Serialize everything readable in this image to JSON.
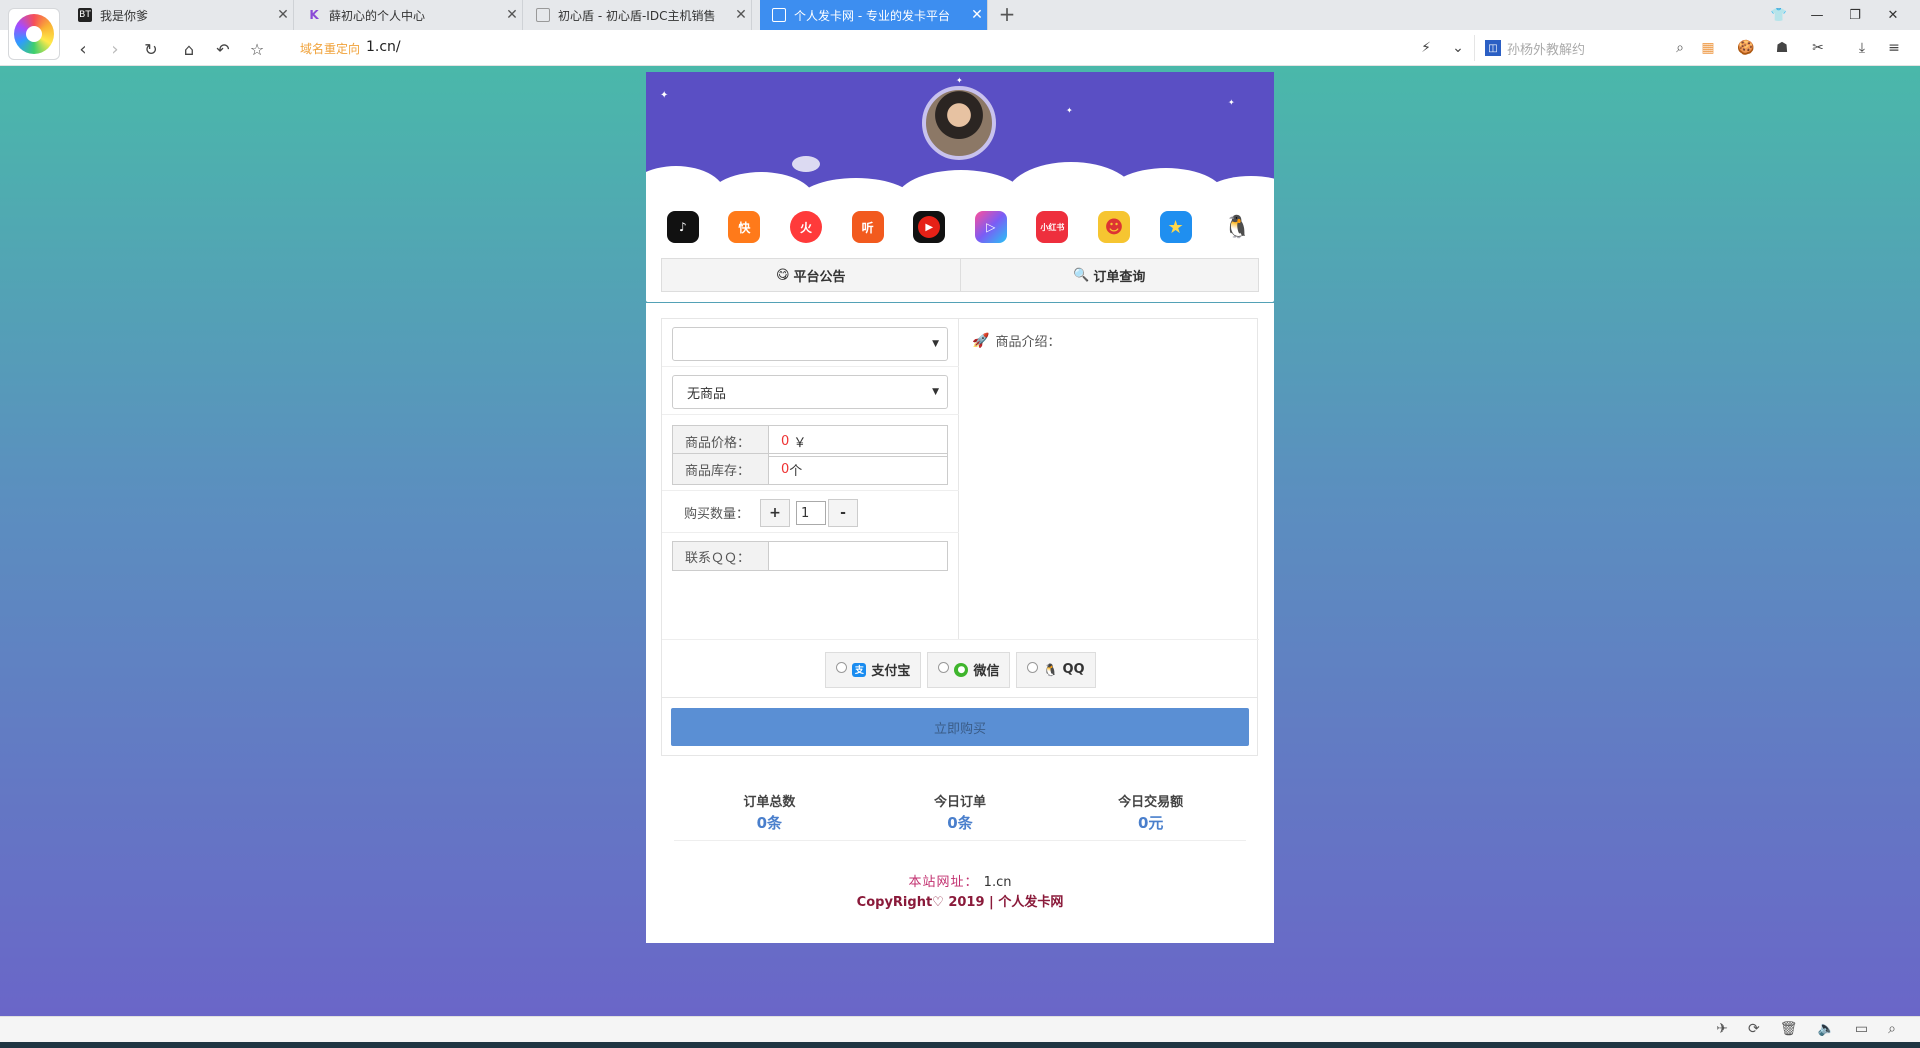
{
  "browser": {
    "tabs": [
      {
        "favicon": "BT",
        "title": "我是你爹"
      },
      {
        "favicon": "K",
        "title": "薛初心的个人中心"
      },
      {
        "favicon": "doc-icon",
        "title": "初心盾 - 初心盾-IDC主机销售"
      },
      {
        "favicon": "doc-icon",
        "title": "个人发卡网 - 专业的发卡平台"
      }
    ],
    "address": {
      "redirect_label": "域名重定向",
      "url": "1.cn/"
    },
    "search_placeholder": "孙杨外教解约"
  },
  "hero": {
    "apps": [
      {
        "name": "douyin",
        "label": "♪",
        "color": "#111111"
      },
      {
        "name": "kuaishou",
        "label": "快",
        "color": "#ff7a1a"
      },
      {
        "name": "huoshan",
        "label": "火",
        "color": "#ff3a3a"
      },
      {
        "name": "huoshan-listen",
        "label": "听",
        "color": "#f25a1e"
      },
      {
        "name": "youtube",
        "label": "▶",
        "color": "#e62117"
      },
      {
        "name": "weishi",
        "label": "▷",
        "color": "#7b5cf5"
      },
      {
        "name": "xiaohongshu",
        "label": "小红书",
        "color": "#ee2f3d"
      },
      {
        "name": "face-app",
        "label": "☻",
        "color": "#f6c531"
      },
      {
        "name": "star-app",
        "label": "★",
        "color": "#1f8ff0"
      },
      {
        "name": "qq",
        "label": "🐧",
        "color": "#ffffff"
      }
    ],
    "notice_label": "平台公告",
    "query_label": "订单查询"
  },
  "form": {
    "category_value": "",
    "product_value": "无商品",
    "price_label": "商品价格：",
    "price_value": "0",
    "price_unit": "￥",
    "stock_label": "商品库存：",
    "stock_value": "0",
    "stock_unit": "个",
    "qty_label": "购买数量：",
    "qty_plus": "+",
    "qty_value": "1",
    "qty_minus": "-",
    "qq_label": "联系ＱＱ：",
    "qq_value": "",
    "intro_label": "商品介绍："
  },
  "payment": [
    {
      "label": "支付宝",
      "icon": "alipay-icon",
      "color": "#1a8cf0",
      "glyph": "支"
    },
    {
      "label": "微信",
      "icon": "wechat-icon",
      "color": "#3fb52d",
      "glyph": "●"
    },
    {
      "label": "QQ",
      "icon": "qq-icon",
      "color": "#ffffff",
      "glyph": "🐧"
    }
  ],
  "buy_label": "立即购买",
  "stats": [
    {
      "label": "订单总数",
      "value": "0条"
    },
    {
      "label": "今日订单",
      "value": "0条"
    },
    {
      "label": "今日交易额",
      "value": "0元"
    }
  ],
  "footer": {
    "site_label": "本站网址：",
    "site_domain": "1.cn",
    "copyright": "CopyRight♡ 2019 | 个人发卡网"
  },
  "colors": {
    "accent": "#3d8ef0",
    "buy_button": "#5a8fd4",
    "banner": "#5a4fc4",
    "stat_value": "#4a7fcc"
  }
}
